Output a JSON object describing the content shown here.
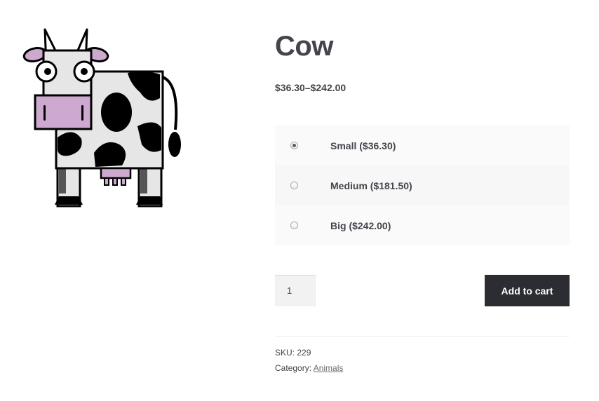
{
  "product": {
    "image_icon": "cow-illustration",
    "title": "Cow",
    "price_range": "$36.30–$242.00",
    "variations": [
      {
        "label": "Small ($36.30)",
        "selected": true
      },
      {
        "label": "Medium ($181.50)",
        "selected": false
      },
      {
        "label": "Big ($242.00)",
        "selected": false
      }
    ],
    "quantity": "1",
    "add_to_cart_label": "Add to cart",
    "sku_label": "SKU:",
    "sku": "229",
    "category_label": "Category:",
    "category": "Animals"
  },
  "colors": {
    "text": "#43454b",
    "button_bg": "#2c2d33",
    "button_text": "#ffffff",
    "udder_pink": "#cda9cf"
  }
}
